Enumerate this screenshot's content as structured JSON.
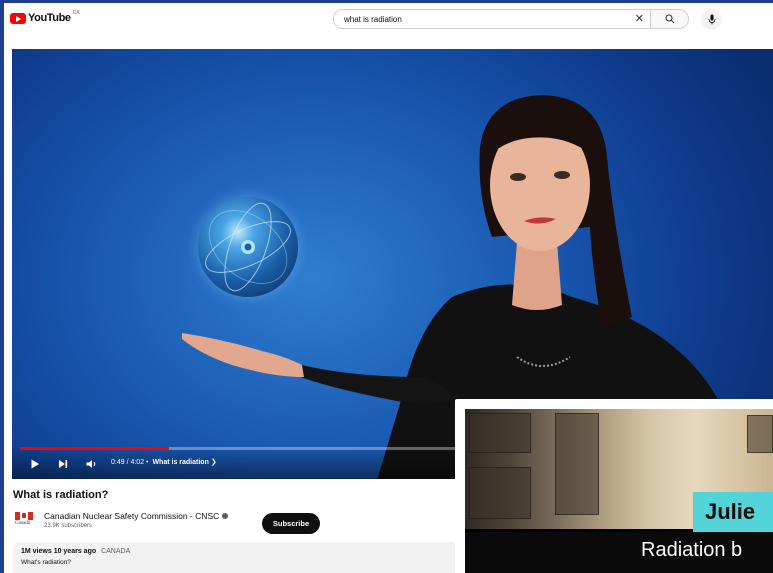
{
  "header": {
    "logo_text": "YouTube",
    "country_code": "CA",
    "search_value": "what is radiation",
    "brand_color": "#ff0000"
  },
  "player": {
    "time": "0:49 / 4:02",
    "chapter": "What is radiation",
    "progress": 0.2
  },
  "video": {
    "title": "What is radiation?",
    "channel_name": "Canadian Nuclear Safety Commission - CNSC",
    "channel_logo_text": "Canadä",
    "subscribers": "23.9K subscribers",
    "subscribe_label": "Subscribe",
    "views": "1M views",
    "age": "10 years ago",
    "location_tag": "CANADA",
    "description": "What's radiation?"
  },
  "overlay": {
    "name_text": "Julie",
    "caption_text": "Radiation b"
  }
}
